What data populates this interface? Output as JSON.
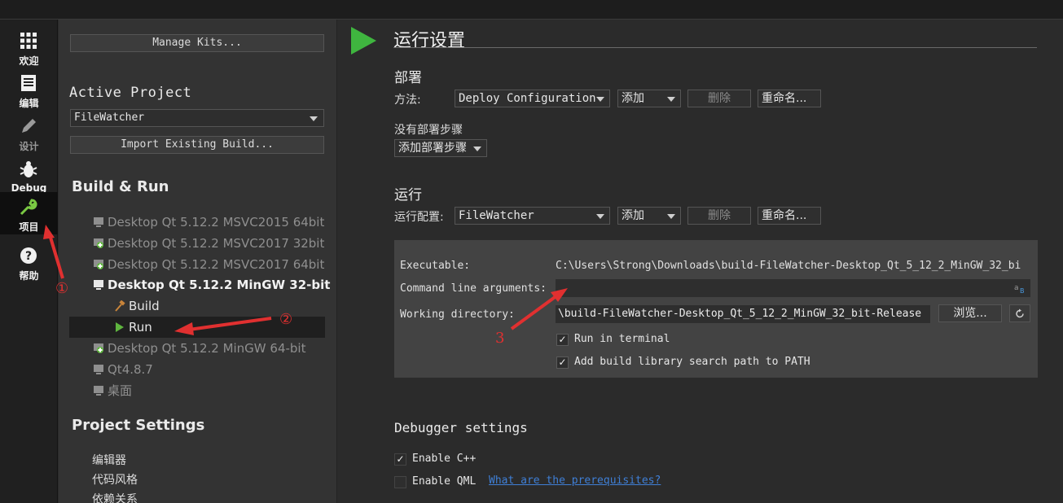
{
  "modes": [
    {
      "label": "欢迎",
      "icon": "grid-icon"
    },
    {
      "label": "编辑",
      "icon": "document-icon"
    },
    {
      "label": "设计",
      "icon": "pen-icon"
    },
    {
      "label": "Debug",
      "icon": "bug-icon"
    },
    {
      "label": "项目",
      "icon": "wrench-icon"
    },
    {
      "label": "帮助",
      "icon": "help-icon"
    }
  ],
  "nav": {
    "manage_kits": "Manage Kits...",
    "active_project_title": "Active Project",
    "active_project_value": "FileWatcher",
    "import_build": "Import Existing Build...",
    "build_run_title": "Build & Run",
    "kits": [
      "Desktop Qt 5.12.2 MSVC2015 64bit",
      "Desktop Qt 5.12.2 MSVC2017 32bit",
      "Desktop Qt 5.12.2 MSVC2017 64bit",
      "Desktop Qt 5.12.2 MinGW 32-bit",
      "Build",
      "Run",
      "Desktop Qt 5.12.2 MinGW 64-bit",
      "Qt4.8.7",
      "桌面"
    ],
    "project_settings_title": "Project Settings",
    "settings": [
      "编辑器",
      "代码风格",
      "依赖关系"
    ]
  },
  "main": {
    "title": "运行设置",
    "deploy": {
      "heading": "部署",
      "method_label": "方法:",
      "config": "Deploy Configuration",
      "add": "添加",
      "remove": "删除",
      "rename": "重命名...",
      "no_steps": "没有部署步骤",
      "add_step": "添加部署步骤"
    },
    "run": {
      "heading": "运行",
      "config_label": "运行配置:",
      "config": "FileWatcher",
      "add": "添加",
      "remove": "删除",
      "rename": "重命名..."
    },
    "details": {
      "executable_label": "Executable:",
      "executable_value": "C:\\Users\\Strong\\Downloads\\build-FileWatcher-Desktop_Qt_5_12_2_MinGW_32_bi",
      "args_label": "Command line arguments:",
      "args_value": "",
      "workdir_label": "Working directory:",
      "workdir_value": "\\build-FileWatcher-Desktop_Qt_5_12_2_MinGW_32_bit-Release",
      "browse": "浏览...",
      "run_in_terminal": "Run in terminal",
      "add_lib_path": "Add build library search path to PATH"
    },
    "debugger": {
      "heading": "Debugger settings",
      "enable_cpp": "Enable C++",
      "enable_qml": "Enable QML",
      "prereq_link": "What are the prerequisites?"
    }
  },
  "annotations": {
    "one": "①",
    "two": "②",
    "three": "3"
  },
  "colors": {
    "accent_green": "#3fb53f",
    "annotation_red": "#e03030",
    "link_blue": "#3f7fd6"
  }
}
